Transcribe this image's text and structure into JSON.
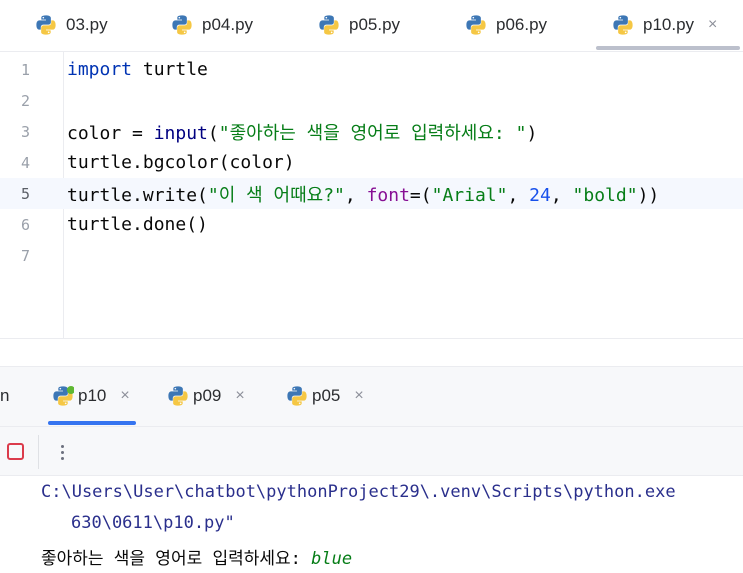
{
  "editor_tabs": [
    {
      "label": "03.py",
      "icon": "python-icon",
      "active": false
    },
    {
      "label": "p04.py",
      "icon": "python-icon",
      "active": false
    },
    {
      "label": "p05.py",
      "icon": "python-icon",
      "active": false
    },
    {
      "label": "p06.py",
      "icon": "python-icon",
      "active": false
    },
    {
      "label": "p10.py",
      "icon": "python-icon",
      "active": true,
      "close": "×"
    }
  ],
  "code_lines": [
    {
      "num": "1",
      "text": "import turtle"
    },
    {
      "num": "2",
      "text": ""
    },
    {
      "num": "3",
      "text": "color = input(\"좋아하는 색을 영어로 입력하세요: \")"
    },
    {
      "num": "4",
      "text": "turtle.bgcolor(color)"
    },
    {
      "num": "5",
      "text": "turtle.write(\"이 색 어때요?\", font=(\"Arial\", 24, \"bold\"))",
      "current": true
    },
    {
      "num": "6",
      "text": "turtle.done()"
    },
    {
      "num": "7",
      "text": ""
    }
  ],
  "run": {
    "label": "n",
    "tabs": [
      {
        "label": "p10",
        "active": true,
        "close": "×"
      },
      {
        "label": "p09",
        "active": false,
        "close": "×"
      },
      {
        "label": "p05",
        "active": false,
        "close": "×"
      }
    ]
  },
  "console": {
    "path_line1": "C:\\Users\\User\\chatbot\\pythonProject29\\.venv\\Scripts\\python.exe",
    "path_line2": "630\\0611\\p10.py\"",
    "prompt": "좋아하는 색을 영어로 입력하세요: ",
    "user_input": "blue"
  },
  "colors": {
    "accent": "#3574f0",
    "stop": "#db3b4b",
    "keyword": "#0033b3",
    "string": "#067d17"
  }
}
